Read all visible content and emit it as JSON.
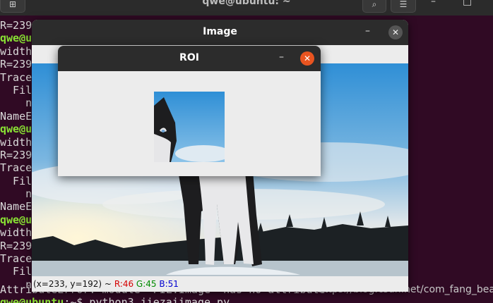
{
  "terminal": {
    "title": "qwe@ubuntu: ~",
    "new_tab_icon": "new-tab-icon",
    "lines": [
      {
        "text": "R=239",
        "prompt": false
      },
      {
        "text": "qwe@ub",
        "prompt": true
      },
      {
        "text": "width=",
        "prompt": false
      },
      {
        "text": "R=239",
        "prompt": false
      },
      {
        "text": "Traceb",
        "prompt": false
      },
      {
        "text": "  File",
        "prompt": false
      },
      {
        "text": "    ng",
        "prompt": false
      },
      {
        "text": "NameEr",
        "prompt": false
      },
      {
        "text": "qwe@ub",
        "prompt": true
      },
      {
        "text": "width=",
        "prompt": false
      },
      {
        "text": "R=239_",
        "prompt": false
      },
      {
        "text": "Traceb",
        "prompt": false
      },
      {
        "text": "  File",
        "prompt": false
      },
      {
        "text": "    ng",
        "prompt": false
      },
      {
        "text": "NameEr",
        "prompt": false
      },
      {
        "text": "qwe@ub",
        "prompt": true
      },
      {
        "text": "width=",
        "prompt": false
      },
      {
        "text": "R=239",
        "prompt": false
      },
      {
        "text": "Traceb",
        "prompt": false
      },
      {
        "text": "  File",
        "prompt": false
      },
      {
        "text": "    ng",
        "prompt": false
      }
    ],
    "bottom_line": "AttributeError: module 'PIL.Image' has no attribute",
    "last_prompt": "qwe@ubuntu",
    "last_command": ":~$ python3 jiezaiimage.py",
    "watermark": "https://blog.csdn.net/com_fang_bean"
  },
  "image_window": {
    "title": "Image",
    "minimize": "–",
    "close": "✕",
    "status": {
      "coords": "(x=233, y=192) ~",
      "r": "R:46",
      "g": "G:45",
      "b": "B:51"
    }
  },
  "roi_window": {
    "title": "ROI",
    "minimize": "–",
    "close": "✕"
  },
  "colors": {
    "terminal_bg": "#300a24",
    "prompt_green": "#8ae234",
    "titlebar": "#2c2c2c",
    "close_orange": "#e95420"
  }
}
